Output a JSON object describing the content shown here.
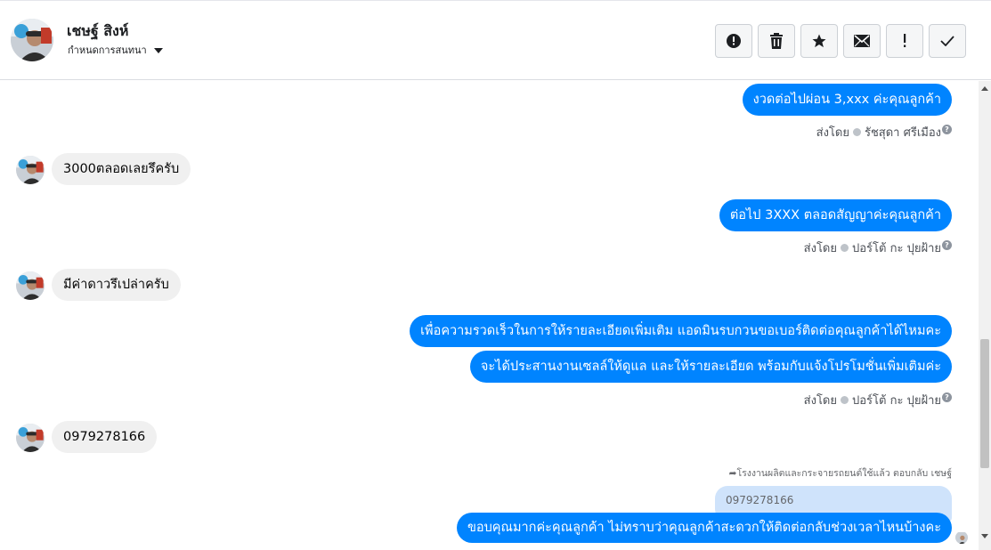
{
  "header": {
    "contact_name": "เชษฐ์ สิงห์",
    "subtitle": "กำหนดการสนทนา",
    "actions": [
      {
        "name": "report-spam",
        "icon": "alert-circle-icon"
      },
      {
        "name": "delete",
        "icon": "trash-icon"
      },
      {
        "name": "star",
        "icon": "star-icon"
      },
      {
        "name": "mark-unread",
        "icon": "envelope-icon"
      },
      {
        "name": "important",
        "icon": "exclamation-icon"
      },
      {
        "name": "done",
        "icon": "check-icon"
      }
    ]
  },
  "messages": {
    "m1": "งวดต่อไปผ่อน 3,xxx ค่ะคุณลูกค้า",
    "m1_sentby_prefix": "ส่งโดย",
    "m1_sender": "รัชสุดา ศรีเมือง",
    "m2": "3000ตลอดเลยรึครับ",
    "m3": "ต่อไป 3XXX  ตลอดสัญญาค่ะคุณลูกค้า",
    "m3_sentby_prefix": "ส่งโดย",
    "m3_sender": "ปอร์โต้ กะ ปุยฝ้าย",
    "m4": "มีค่าดาวรึเปล่าครับ",
    "m5a": "เพื่อความรวดเร็วในการให้รายละเอียดเพิ่มเติม แอดมินรบกวนขอเบอร์ติดต่อคุณลูกค้าได้ไหมคะ",
    "m5b": "จะได้ประสานงานเซลล์ให้ดูแล และให้รายละเอียด พร้อมกับแจ้งโปรโมชั่นเพิ่มเติมค่ะ",
    "m5_sentby_prefix": "ส่งโดย",
    "m5_sender": "ปอร์โต้ กะ ปุยฝ้าย",
    "m6": "0979278166",
    "reply_note": "โรงงานผลิตและกระจายรถยนต์ใช้แล้ว ตอบกลับ เชษฐ์",
    "quoted": "0979278166",
    "m7": "ขอบคุณมากค่ะคุณลูกค้า ไม่ทราบว่าคุณลูกค้าสะดวกให้ติดต่อกลับช่วงเวลาไหนบ้างคะ"
  },
  "colors": {
    "outgoing_bubble": "#0084ff",
    "incoming_bubble": "#f0f0f0",
    "quoted_bubble": "#cfe3fb"
  }
}
